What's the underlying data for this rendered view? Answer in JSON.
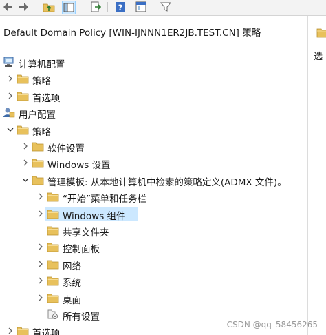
{
  "toolbar": {
    "buttons": [
      "back-icon",
      "forward-icon",
      "up-folder-icon",
      "show-hide-tree-icon",
      "export-list-icon",
      "help-icon",
      "properties-icon",
      "filter-icon"
    ]
  },
  "tree": {
    "title": "Default Domain Policy [WIN-IJNNN1ER2JB.TEST.CN] 策略",
    "items": [
      {
        "label": "计算机配置",
        "level": 0,
        "icon": "computer-icon",
        "expander": "none"
      },
      {
        "label": "策略",
        "level": 1,
        "icon": "folder-icon",
        "expander": "collapsed"
      },
      {
        "label": "首选项",
        "level": 1,
        "icon": "folder-icon",
        "expander": "collapsed"
      },
      {
        "label": "用户配置",
        "level": 0,
        "icon": "user-icon",
        "expander": "none"
      },
      {
        "label": "策略",
        "level": 1,
        "icon": "folder-icon",
        "expander": "expanded"
      },
      {
        "label": "软件设置",
        "level": 2,
        "icon": "folder-icon",
        "expander": "collapsed"
      },
      {
        "label": "Windows 设置",
        "level": 2,
        "icon": "folder-icon",
        "expander": "collapsed"
      },
      {
        "label": "管理模板: 从本地计算机中检索的策略定义(ADMX 文件)。",
        "level": 2,
        "icon": "folder-icon",
        "expander": "expanded"
      },
      {
        "label": "“开始”菜单和任务栏",
        "level": 3,
        "icon": "folder-icon",
        "expander": "collapsed"
      },
      {
        "label": "Windows 组件",
        "level": 3,
        "icon": "folder-icon",
        "expander": "collapsed",
        "selected": true
      },
      {
        "label": "共享文件夹",
        "level": 3,
        "icon": "folder-icon",
        "expander": "none"
      },
      {
        "label": "控制面板",
        "level": 3,
        "icon": "folder-icon",
        "expander": "collapsed"
      },
      {
        "label": "网络",
        "level": 3,
        "icon": "folder-icon",
        "expander": "collapsed"
      },
      {
        "label": "系统",
        "level": 3,
        "icon": "folder-icon",
        "expander": "collapsed"
      },
      {
        "label": "桌面",
        "level": 3,
        "icon": "folder-icon",
        "expander": "collapsed"
      },
      {
        "label": "所有设置",
        "level": 3,
        "icon": "settings-list-icon",
        "expander": "none"
      },
      {
        "label": "首选项",
        "level": 1,
        "icon": "folder-icon",
        "expander": "collapsed"
      }
    ]
  },
  "right_pane": {
    "label": "选"
  },
  "watermark": "CSDN @qq_58456265",
  "colors": {
    "selection": "#cce8ff",
    "folder": "#e8c15c"
  }
}
